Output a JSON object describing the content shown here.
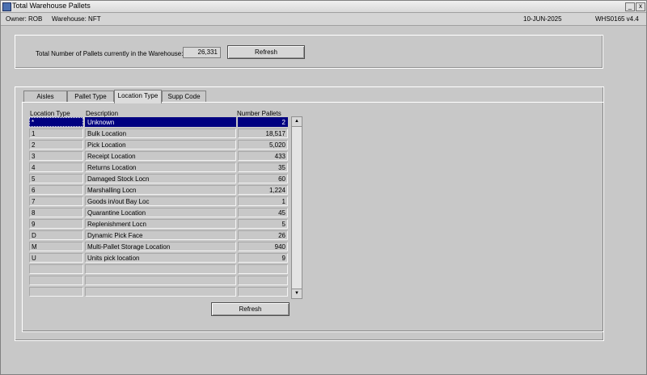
{
  "window": {
    "title": "Total Warehouse Pallets",
    "minimize_label": "_",
    "close_label": "x"
  },
  "info": {
    "owner": "Owner:  ROB",
    "warehouse": "Warehouse:  NFT",
    "date": "10-JUN-2025",
    "module": "WHS0165  v4.4"
  },
  "summary": {
    "label": "Total Number of Pallets currently in the Warehouse:",
    "value": "26,331",
    "refresh_label": "Refresh"
  },
  "tabs": [
    {
      "label": "Aisles"
    },
    {
      "label": "Pallet Type"
    },
    {
      "label": "Location Type"
    },
    {
      "label": "Supp Code"
    }
  ],
  "active_tab": "Location Type",
  "grid": {
    "headers": [
      "Location Type",
      "Description",
      "Number Pallets"
    ],
    "rows": [
      {
        "type": "*",
        "description": "Unknown",
        "pallets": "2"
      },
      {
        "type": "1",
        "description": "Bulk Location",
        "pallets": "18,517"
      },
      {
        "type": "2",
        "description": "Pick Location",
        "pallets": "5,020"
      },
      {
        "type": "3",
        "description": "Receipt Location",
        "pallets": "433"
      },
      {
        "type": "4",
        "description": "Returns Location",
        "pallets": "35"
      },
      {
        "type": "5",
        "description": "Damaged Stock Locn",
        "pallets": "60"
      },
      {
        "type": "6",
        "description": "Marshalling Locn",
        "pallets": "1,224"
      },
      {
        "type": "7",
        "description": "Goods in/out Bay Loc",
        "pallets": "1"
      },
      {
        "type": "8",
        "description": "Quarantine Location",
        "pallets": "45"
      },
      {
        "type": "9",
        "description": "Replenishment Locn",
        "pallets": "5"
      },
      {
        "type": "D",
        "description": "Dynamic Pick Face",
        "pallets": "26"
      },
      {
        "type": "M",
        "description": "Multi-Pallet Storage Location",
        "pallets": "940"
      },
      {
        "type": "U",
        "description": "Units pick location",
        "pallets": "9"
      },
      {
        "type": "",
        "description": "",
        "pallets": ""
      },
      {
        "type": "",
        "description": "",
        "pallets": ""
      },
      {
        "type": "",
        "description": "",
        "pallets": ""
      }
    ],
    "selected_row": 0,
    "scroll_up": "▲",
    "scroll_down": "▼",
    "refresh_label": "Refresh"
  }
}
